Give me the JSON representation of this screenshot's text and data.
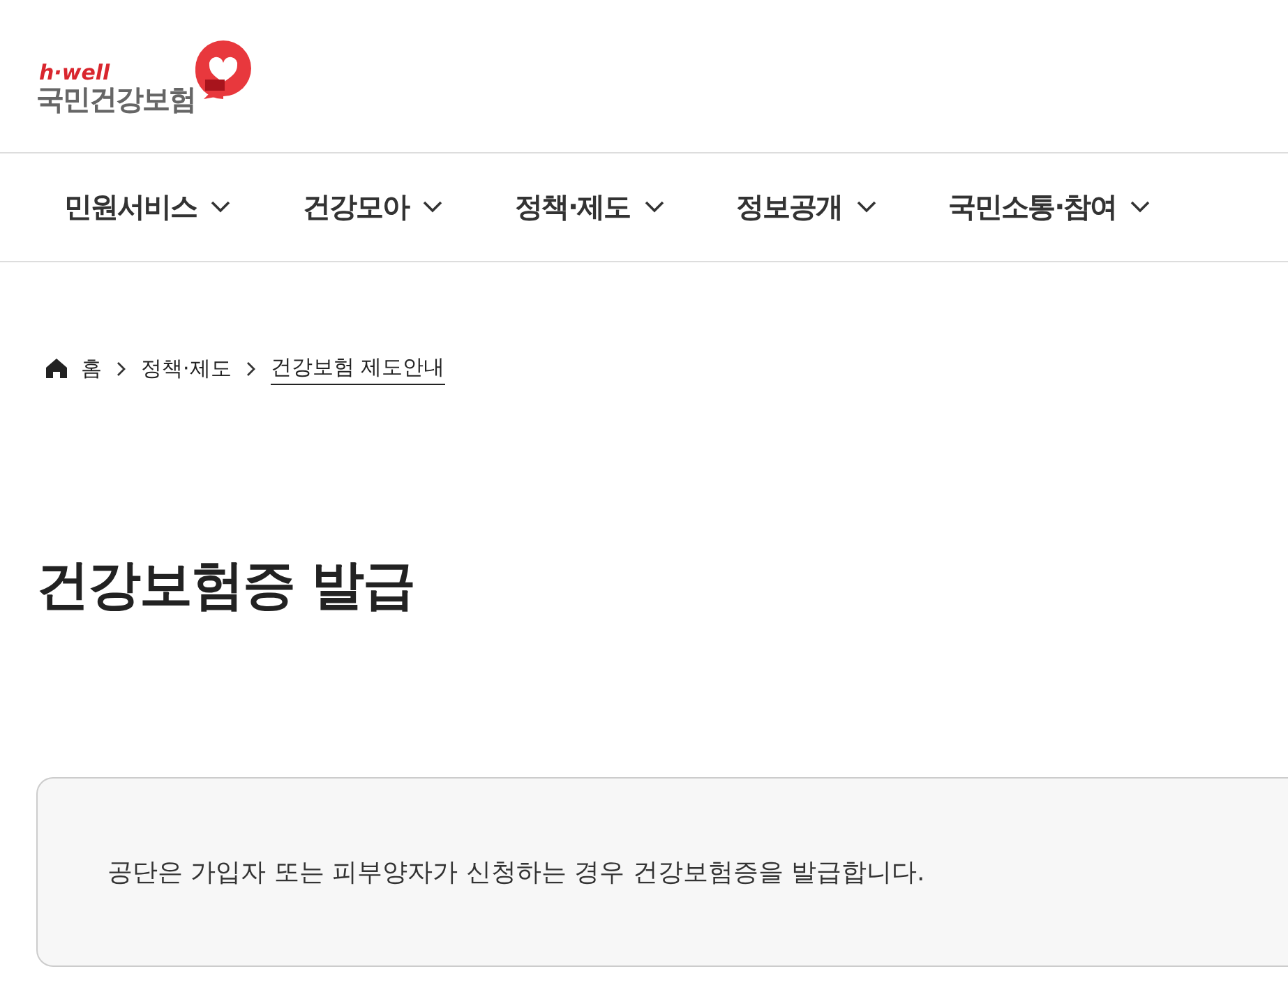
{
  "logo": {
    "tagline": "h·well",
    "name": "국민건강보험"
  },
  "nav": [
    {
      "label": "민원서비스",
      "expanded": false
    },
    {
      "label": "건강모아",
      "expanded": false
    },
    {
      "label": "정책·제도",
      "expanded": false
    },
    {
      "label": "정보공개",
      "expanded": false
    },
    {
      "label": "국민소통·참여",
      "expanded": false
    }
  ],
  "breadcrumb": [
    {
      "label": "홈",
      "kind": "home"
    },
    {
      "label": "정책·제도",
      "kind": "link"
    },
    {
      "label": "건강보험 제도안내",
      "kind": "current"
    }
  ],
  "page_title": "건강보험증 발급",
  "notice": "공단은 가입자 또는 피부양자가 신청하는 경우 건강보험증을 발급합니다."
}
